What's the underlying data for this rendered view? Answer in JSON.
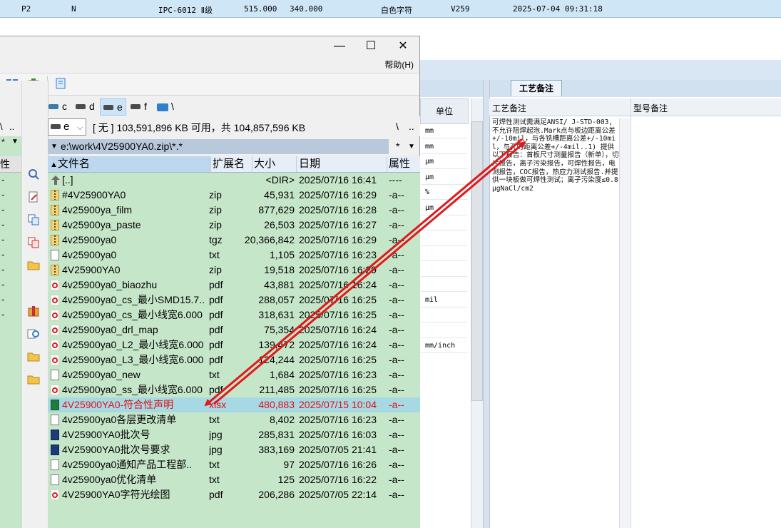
{
  "background_app": {
    "top_row": [
      "P2",
      "N",
      "IPC-6012 Ⅱ级",
      "515.000",
      "340.000",
      "白色字符",
      "V259",
      "2025-07-04 09:31:18"
    ],
    "tab_label": "工艺备注",
    "unit_header": "单位",
    "unit_values": [
      "mm",
      "mm",
      "μm",
      "μm",
      "%",
      "μm",
      "",
      "",
      "",
      "",
      "",
      "mil",
      "",
      "",
      "mm/inch"
    ],
    "notes_headers": {
      "craft": "工艺备注",
      "model": "型号备注"
    },
    "craft_note": "可焊性测试需满足ANSI/ J-STD-003,不允许阻焊起泡.Mark点与板边距离公差+/-10mil，与各铣槽距离公差+/-10mil，与孔的距离公差+/-4mil..1) 提供以下报告：首板尺寸测量报告（新单），切片报告，离子污染报告，可焊性报告，电测报告，COC报告，热应力测试报告.并提供一块板做可焊性测试；离子污染度≤0.8μgNaCl/cm2"
  },
  "file_manager": {
    "window_controls": {
      "minimize": "—",
      "maximize": "☐",
      "close": "✕"
    },
    "menu_help": "帮助(H)",
    "drives": [
      "c",
      "d",
      "e",
      "f",
      "\\"
    ],
    "left_panel": {
      "header_label": "性",
      "row_marks": [
        "-",
        "-",
        "-",
        "-",
        "-",
        "-",
        "-",
        "-",
        "-",
        "-"
      ]
    },
    "right_panel": {
      "drive_value": "e",
      "free_info": "[ 无 ]  103,591,896 KB 可用，共 104,857,596 KB",
      "path": "e:\\work\\4V25900YA0.zip\\*.*",
      "path_right": [
        "\\",
        "..",
        "*"
      ],
      "columns": {
        "name": "文件名",
        "ext": "扩展名",
        "size": "大小",
        "date": "日期",
        "attr": "属性"
      },
      "files": [
        {
          "icon": "up",
          "name": "[..]",
          "ext": "",
          "size": "<DIR>",
          "date": "2025/07/16 16:41",
          "attr": "----"
        },
        {
          "icon": "zip",
          "name": "#4V25900YA0",
          "ext": "zip",
          "size": "45,931",
          "date": "2025/07/16 16:29",
          "attr": "-a--"
        },
        {
          "icon": "zip",
          "name": "4v25900ya_film",
          "ext": "zip",
          "size": "877,629",
          "date": "2025/07/16 16:28",
          "attr": "-a--"
        },
        {
          "icon": "zip",
          "name": "4v25900ya_paste",
          "ext": "zip",
          "size": "26,503",
          "date": "2025/07/16 16:27",
          "attr": "-a--"
        },
        {
          "icon": "zip",
          "name": "4v25900ya0",
          "ext": "tgz",
          "size": "20,366,842",
          "date": "2025/07/16 16:29",
          "attr": "-a--"
        },
        {
          "icon": "txt",
          "name": "4v25900ya0",
          "ext": "txt",
          "size": "1,105",
          "date": "2025/07/16 16:23",
          "attr": "-a--"
        },
        {
          "icon": "zip",
          "name": "4V25900YA0",
          "ext": "zip",
          "size": "19,518",
          "date": "2025/07/16 16:29",
          "attr": "-a--"
        },
        {
          "icon": "pdf",
          "name": "4v25900ya0_biaozhu",
          "ext": "pdf",
          "size": "43,881",
          "date": "2025/07/16 16:24",
          "attr": "-a--"
        },
        {
          "icon": "pdf",
          "name": "4v25900ya0_cs_最小SMD15.7..",
          "ext": "pdf",
          "size": "288,057",
          "date": "2025/07/16 16:25",
          "attr": "-a--"
        },
        {
          "icon": "pdf",
          "name": "4v25900ya0_cs_最小线宽6.000",
          "ext": "pdf",
          "size": "318,631",
          "date": "2025/07/16 16:25",
          "attr": "-a--"
        },
        {
          "icon": "pdf",
          "name": "4v25900ya0_drl_map",
          "ext": "pdf",
          "size": "75,354",
          "date": "2025/07/16 16:24",
          "attr": "-a--"
        },
        {
          "icon": "pdf",
          "name": "4v25900ya0_L2_最小线宽6.000",
          "ext": "pdf",
          "size": "139,472",
          "date": "2025/07/16 16:24",
          "attr": "-a--"
        },
        {
          "icon": "pdf",
          "name": "4v25900ya0_L3_最小线宽6.000",
          "ext": "pdf",
          "size": "124,244",
          "date": "2025/07/16 16:25",
          "attr": "-a--"
        },
        {
          "icon": "txt",
          "name": "4v25900ya0_new",
          "ext": "txt",
          "size": "1,684",
          "date": "2025/07/16 16:23",
          "attr": "-a--"
        },
        {
          "icon": "pdf",
          "name": "4v25900ya0_ss_最小线宽6.000",
          "ext": "pdf",
          "size": "211,485",
          "date": "2025/07/16 16:25",
          "attr": "-a--"
        },
        {
          "icon": "xlsx",
          "name": "4V25900YA0-符合性声明",
          "ext": "xlsx",
          "size": "480,883",
          "date": "2025/07/15 10:04",
          "attr": "-a--",
          "selected": true
        },
        {
          "icon": "txt",
          "name": "4v25900ya0各层更改清单",
          "ext": "txt",
          "size": "8,402",
          "date": "2025/07/16 16:23",
          "attr": "-a--"
        },
        {
          "icon": "jpg",
          "name": "4V25900YA0批次号",
          "ext": "jpg",
          "size": "285,831",
          "date": "2025/07/16 16:03",
          "attr": "-a--"
        },
        {
          "icon": "jpg",
          "name": "4V25900YA0批次号要求",
          "ext": "jpg",
          "size": "383,169",
          "date": "2025/07/05 21:41",
          "attr": "-a--"
        },
        {
          "icon": "txt",
          "name": "4v25900ya0通知产品工程部..",
          "ext": "txt",
          "size": "97",
          "date": "2025/07/16 16:26",
          "attr": "-a--"
        },
        {
          "icon": "txt",
          "name": "4v25900ya0优化清单",
          "ext": "txt",
          "size": "125",
          "date": "2025/07/16 16:22",
          "attr": "-a--"
        },
        {
          "icon": "pdf",
          "name": "4V25900YA0字符光绘图",
          "ext": "pdf",
          "size": "206,286",
          "date": "2025/07/05 22:14",
          "attr": "-a--"
        }
      ]
    }
  },
  "annotation": {
    "arrow_color": "#e0191b",
    "selected_text_color": "#e01010"
  }
}
